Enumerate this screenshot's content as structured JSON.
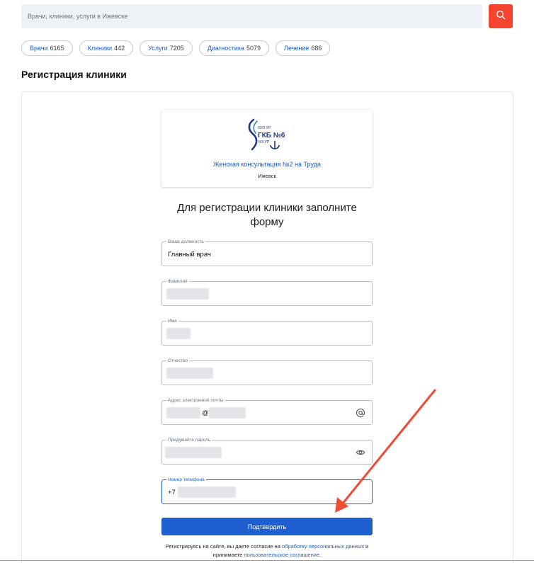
{
  "search": {
    "placeholder": "Врачи, клиники, услуги в Ижевске"
  },
  "chips": [
    {
      "label": "Врачи",
      "count": "6165"
    },
    {
      "label": "Клиники",
      "count": "442"
    },
    {
      "label": "Услуги",
      "count": "7205"
    },
    {
      "label": "Диагностика",
      "count": "5079"
    },
    {
      "label": "Лечение",
      "count": "686"
    }
  ],
  "page_title": "Регистрация клиники",
  "clinic": {
    "logo_top": "БУЗ УР",
    "logo_main": "ГКБ №6",
    "logo_bottom": "МЗ УР",
    "name": "Женская консультация №2 на Труда",
    "city": "Ижевск"
  },
  "form": {
    "heading": "Для регистрации клиники заполните форму",
    "fields": {
      "position": {
        "label": "Ваша должность",
        "value": "Главный врач"
      },
      "surname": {
        "label": "Фамилия",
        "value": ""
      },
      "name": {
        "label": "Имя",
        "value": ""
      },
      "patronymic": {
        "label": "Отчество",
        "value": ""
      },
      "email": {
        "label": "Адрес электронной почты",
        "value": "@"
      },
      "password": {
        "label": "Придумайте пароль",
        "value": ""
      },
      "phone": {
        "label": "Номер телефона",
        "value": "+7"
      }
    },
    "submit_label": "Подтвердить",
    "consent": {
      "prefix": "Регистрируясь на сайте, вы даете согласие на",
      "link1": "обработку персональных данных",
      "middle": "и принимаете",
      "link2": "пользовательское соглашение",
      "suffix": "."
    }
  },
  "colors": {
    "accent": "#1d5ed1",
    "search_button": "#f4442e",
    "annotation_arrow": "#ef4b35"
  },
  "icons": {
    "search_button": "search-icon",
    "email_field": "at-icon",
    "password_field": "eye-icon"
  }
}
